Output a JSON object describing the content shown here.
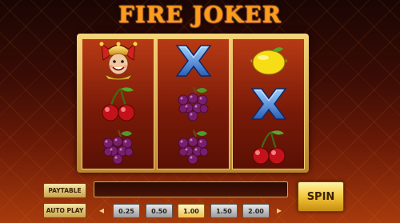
{
  "game": {
    "title": "FIRE JOKER"
  },
  "reels": [
    {
      "symbols": [
        "joker-icon",
        "cherries-icon",
        "grapes-icon"
      ]
    },
    {
      "symbols": [
        "x-icon",
        "grapes-icon",
        "grapes-icon"
      ]
    },
    {
      "symbols": [
        "lemon-icon",
        "x-icon",
        "cherries-icon"
      ]
    }
  ],
  "controls": {
    "paytable_label": "PAYTABLE",
    "autoplay_label": "AUTO PLAY",
    "spin_label": "SPIN",
    "bet_options": [
      "0.25",
      "0.50",
      "1.00",
      "1.50",
      "2.00"
    ],
    "selected_bet": "1.00",
    "prev_icon": "chevron-left-icon",
    "next_icon": "chevron-right-icon"
  },
  "colors": {
    "accent": "#f3c63a",
    "title": "#ff9a1a",
    "reel": "#7a1a08"
  }
}
